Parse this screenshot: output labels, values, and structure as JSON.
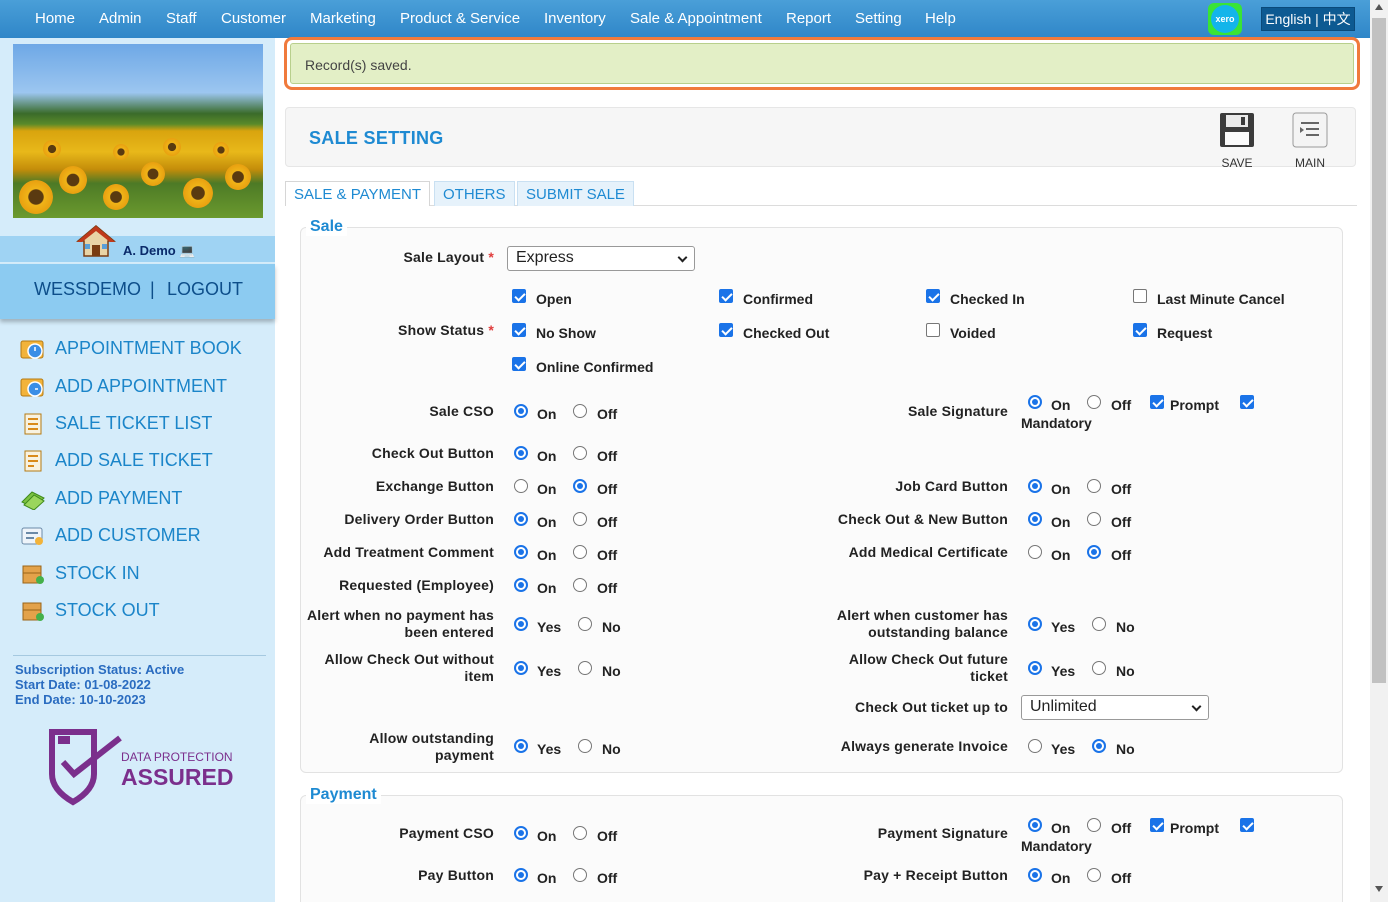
{
  "topnav": {
    "items": [
      "Home",
      "Admin",
      "Staff",
      "Customer",
      "Marketing",
      "Product & Service",
      "Inventory",
      "Sale & Appointment",
      "Report",
      "Setting",
      "Help"
    ],
    "xero_label": "xero",
    "language": "English | 中文"
  },
  "sidebar": {
    "user": "A. Demo",
    "account": "WESSDEMO",
    "separator": "|",
    "logout": "LOGOUT",
    "menu": [
      {
        "label": "APPOINTMENT BOOK",
        "icon": "appointment-book-icon"
      },
      {
        "label": "ADD APPOINTMENT",
        "icon": "add-appointment-icon"
      },
      {
        "label": "SALE TICKET LIST",
        "icon": "sale-ticket-list-icon"
      },
      {
        "label": "ADD SALE TICKET",
        "icon": "add-sale-ticket-icon"
      },
      {
        "label": "ADD PAYMENT",
        "icon": "add-payment-icon"
      },
      {
        "label": "ADD CUSTOMER",
        "icon": "add-customer-icon"
      },
      {
        "label": "STOCK IN",
        "icon": "stock-in-icon"
      },
      {
        "label": "STOCK OUT",
        "icon": "stock-out-icon"
      }
    ],
    "subscription": {
      "status": "Subscription Status: Active",
      "start": "Start Date: 01-08-2022",
      "end": "End Date: 10-10-2023"
    },
    "badge": {
      "line1": "DATA PROTECTION",
      "line2": "ASSURED"
    }
  },
  "alert": "Record(s) saved.",
  "header": {
    "title": "SALE SETTING",
    "save": "SAVE",
    "main": "MAIN"
  },
  "tabs": [
    "SALE & PAYMENT",
    "OTHERS",
    "SUBMIT SALE"
  ],
  "sale": {
    "legend": "Sale",
    "sale_layout_label": "Sale Layout",
    "sale_layout_value": "Express",
    "show_status_label": "Show Status",
    "required_mark": "*",
    "statuses": [
      {
        "label": "Open",
        "checked": true
      },
      {
        "label": "Confirmed",
        "checked": true
      },
      {
        "label": "Checked In",
        "checked": true
      },
      {
        "label": "Last Minute Cancel",
        "checked": false
      },
      {
        "label": "No Show",
        "checked": true
      },
      {
        "label": "Checked Out",
        "checked": true
      },
      {
        "label": "Voided",
        "checked": false
      },
      {
        "label": "Request",
        "checked": true
      },
      {
        "label": "Online Confirmed",
        "checked": true
      }
    ],
    "words": {
      "on": "On",
      "off": "Off",
      "yes": "Yes",
      "no": "No",
      "prompt": "Prompt",
      "mandatory": "Mandatory"
    },
    "left": [
      {
        "label": "Sale CSO",
        "value": "On"
      },
      {
        "label": "Check Out Button",
        "value": "On"
      },
      {
        "label": "Exchange Button",
        "value": "Off"
      },
      {
        "label": "Delivery Order Button",
        "value": "On"
      },
      {
        "label": "Add Treatment Comment",
        "value": "On"
      },
      {
        "label": "Requested (Employee)",
        "value": "On"
      },
      {
        "label": "Alert when no payment has been entered",
        "value": "Yes"
      },
      {
        "label": "Allow Check Out without item",
        "value": "Yes"
      },
      {
        "label": "Allow outstanding payment",
        "value": "Yes"
      }
    ],
    "right": [
      {
        "label": "Sale Signature",
        "value": "On",
        "prompt": true,
        "mandatory": true
      },
      {
        "label": "Job Card Button",
        "value": "On"
      },
      {
        "label": "Check Out & New Button",
        "value": "On"
      },
      {
        "label": "Add Medical Certificate",
        "value": "Off"
      },
      {
        "label": "Alert when customer has outstanding balance",
        "value": "Yes"
      },
      {
        "label": "Allow Check Out future ticket",
        "value": "Yes"
      },
      {
        "label": "Check Out ticket up to",
        "value": "Unlimited"
      },
      {
        "label": "Always generate Invoice",
        "value": "No"
      }
    ]
  },
  "payment": {
    "legend": "Payment",
    "left": [
      {
        "label": "Payment CSO",
        "value": "On"
      },
      {
        "label": "Pay Button",
        "value": "On"
      }
    ],
    "right": [
      {
        "label": "Payment Signature",
        "value": "On",
        "prompt": true,
        "mandatory": true
      },
      {
        "label": "Pay + Receipt Button",
        "value": "On"
      }
    ]
  },
  "colors": {
    "nav": "#2f86c8",
    "accent": "#1e8ad2",
    "alert_border": "#f07a3c",
    "alert_bg": "#e3efc6",
    "sidebar": "#d5ecfa",
    "xero_frame": "#39e436"
  }
}
